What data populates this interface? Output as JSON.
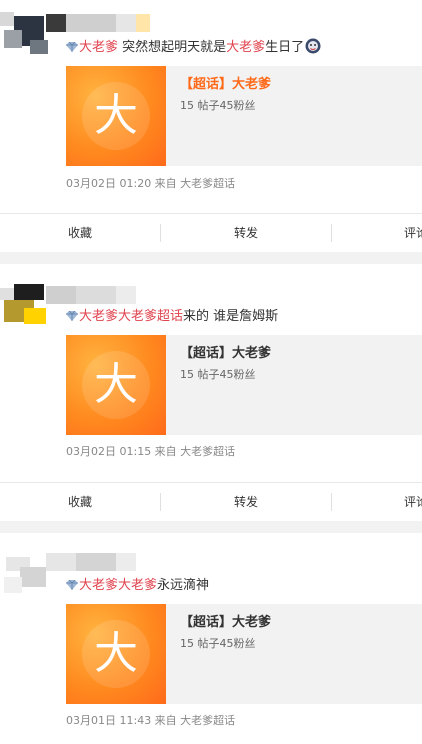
{
  "posts": [
    {
      "tag1": "大老爹",
      "mid1": " 突然想起明天就是",
      "tag2": "大老爹",
      "tail": "生日了",
      "topic": {
        "title": "【超话】大老爹",
        "stats": "15 帖子45粉丝"
      },
      "meta": "03月02日 01:20  来自 大老爹超话",
      "actions": {
        "fav": "收藏",
        "forward": "转发",
        "comment": "评论"
      }
    },
    {
      "tag1": "大老爹大老爹超话",
      "tail": "来的 谁是詹姆斯",
      "topic": {
        "title": "【超话】大老爹",
        "stats": "15 帖子45粉丝"
      },
      "meta": "03月02日 01:15  来自 大老爹超话",
      "actions": {
        "fav": "收藏",
        "forward": "转发",
        "comment": "评论"
      }
    },
    {
      "tag1": "大老爹大老爹",
      "tail": "永远滴神",
      "topic": {
        "title": "【超话】大老爹",
        "stats": "15 帖子45粉丝"
      },
      "meta": "03月01日 11:43  来自 大老爹超话"
    }
  ],
  "thumb_char": "大",
  "colors": {
    "tag": "#e0434e",
    "topic_orange": "#ff6a1a"
  },
  "icons": {
    "tag": "diamond-icon",
    "emoji": "emoji-icon"
  }
}
